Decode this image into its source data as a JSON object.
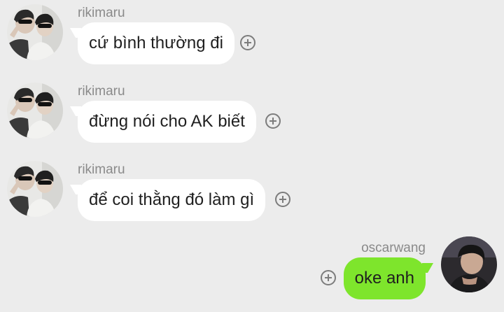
{
  "colors": {
    "background": "#ececec",
    "incoming_bubble": "#ffffff",
    "outgoing_bubble": "#7ee52c",
    "sender_name": "#8a8a8a",
    "message_text": "#1f1f1f"
  },
  "messages": [
    {
      "sender": "rikimaru",
      "text": "cứ bình thường đi",
      "direction": "incoming",
      "reaction_icon": "add-reaction-icon"
    },
    {
      "sender": "rikimaru",
      "text": "đừng nói cho AK biết",
      "direction": "incoming",
      "reaction_icon": "add-reaction-icon"
    },
    {
      "sender": "rikimaru",
      "text": "để coi thằng đó làm gì",
      "direction": "incoming",
      "reaction_icon": "add-reaction-icon"
    },
    {
      "sender": "oscarwang",
      "text": "oke anh",
      "direction": "outgoing",
      "reaction_icon": "add-reaction-icon"
    }
  ]
}
